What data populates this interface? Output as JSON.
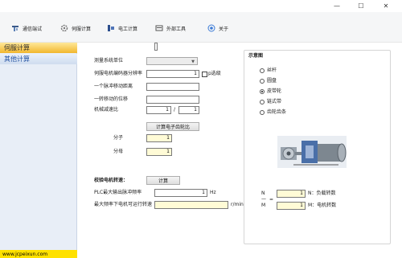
{
  "window": {
    "minimize_glyph": "—",
    "maximize_glyph": "☐",
    "close_glyph": "✕"
  },
  "toolbar": {
    "items": [
      {
        "label": "通信端试",
        "icon": "tools-icon"
      },
      {
        "label": "伺服计算",
        "icon": "gear-icon"
      },
      {
        "label": "电工计算",
        "icon": "electric-icon"
      },
      {
        "label": "外部工具",
        "icon": "folder-icon"
      },
      {
        "label": "关于",
        "icon": "info-icon"
      }
    ]
  },
  "sidebar": {
    "items": [
      {
        "label": "伺服计算",
        "active": true
      },
      {
        "label": "其他计算",
        "active": false
      }
    ],
    "footer_link": "www.jcpeixun.com"
  },
  "form": {
    "unit_label": "测量系统单位",
    "unit_value": "",
    "encoder_label": "伺服电机编码器分辨率",
    "encoder_value": "1",
    "encoder_check_label": "p选级",
    "pulse_distance_label": "一个脉冲移动距离",
    "pulse_distance_value": "",
    "rev_distance_label": "一转移动的位移",
    "rev_distance_value": "",
    "ratio_label": "机械减速比",
    "ratio_a": "1",
    "ratio_sep": "/",
    "ratio_b": "1",
    "calc_gear_button": "计算电子齿轮比",
    "numerator_label": "分子",
    "numerator_value": "1",
    "denominator_label": "分母",
    "denominator_value": "1"
  },
  "verify": {
    "title": "校验电机转速：",
    "calc_button": "计算",
    "plc_label": "PLC最大输出脉冲频率",
    "plc_value": "1",
    "plc_unit": "Hz",
    "max_speed_label": "最大频率下电机可运行转速",
    "max_speed_value": "",
    "max_speed_unit": "r/min"
  },
  "diagram": {
    "title": "示意图",
    "options": [
      {
        "label": "丝杆",
        "selected": false
      },
      {
        "label": "圆盘",
        "selected": false
      },
      {
        "label": "皮带轮",
        "selected": true
      },
      {
        "label": "链式带",
        "selected": false
      },
      {
        "label": "齿轮齿条",
        "selected": false
      }
    ],
    "n_label": "N",
    "m_label": "M",
    "dash": "—",
    "eq": "=",
    "n_value": "1",
    "m_value": "1",
    "n_desc": "N：负载转数",
    "m_desc": "M：电机转数"
  }
}
